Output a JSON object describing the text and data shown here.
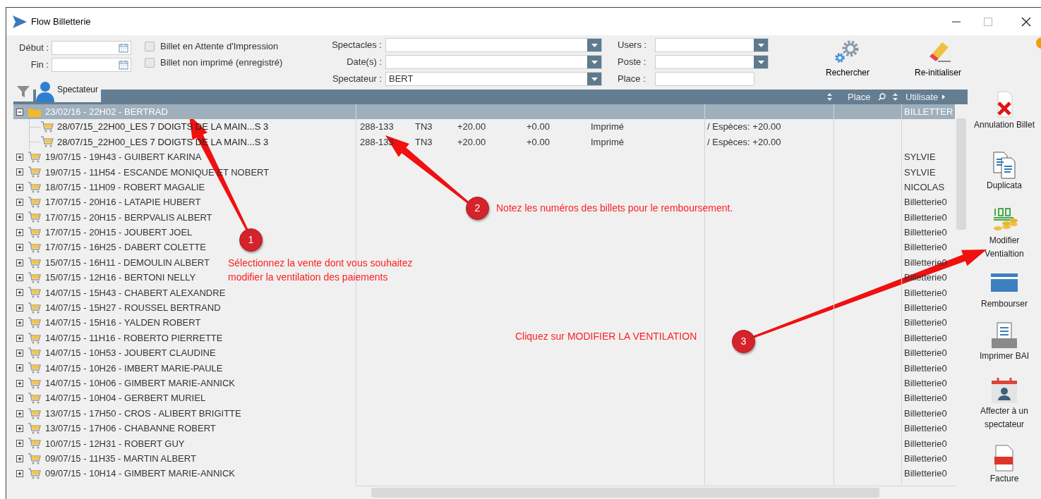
{
  "window": {
    "title": "Flow Billetterie"
  },
  "filters": {
    "dates": [
      {
        "label": "Début :"
      },
      {
        "label": "Fin :"
      }
    ],
    "checkboxes": [
      {
        "label": "Billet en Attente d'Impression",
        "checked": false
      },
      {
        "label": "Billet non imprimé (enregistré)",
        "checked": false
      }
    ],
    "combos": [
      {
        "label": "Spectacles :"
      },
      {
        "label": "Date(s) :"
      },
      {
        "label": "Spectateur :",
        "value": "BERT"
      }
    ],
    "combos_2": [
      {
        "label": "Users :",
        "kind": "dropdown"
      },
      {
        "label": "Poste :",
        "kind": "dropdown"
      },
      {
        "label": "Place :",
        "kind": "text"
      }
    ],
    "actions": [
      {
        "label": "Rechercher",
        "kind": "search"
      },
      {
        "label": "Re-initialiser",
        "kind": "reset"
      }
    ]
  },
  "tab": {
    "label": "Spectateur",
    "selected": true
  },
  "grid": {
    "headers": [
      {
        "label": "Place"
      },
      {
        "label": "Utilisate"
      }
    ],
    "rows": [
      {
        "label": "23/02/16 - 22H02 - BERTRAD",
        "user": "BILLETTER",
        "expanded": true,
        "selected": true,
        "children": [
          {
            "label": "28/07/15_22H00_LES 7 DOIGTS DE LA MAIN...S 3",
            "ticket": "288-133",
            "tarif": "TN3",
            "amount": "+20.00",
            "discount": "+0.00",
            "status": "Imprimé",
            "payment": "/ Espèces: +20.00"
          },
          {
            "label": "28/07/15_22H00_LES 7 DOIGTS DE LA MAIN...S 3",
            "ticket": "288-133",
            "tarif": "TN3",
            "amount": "+20.00",
            "discount": "+0.00",
            "status": "Imprimé",
            "payment": "/ Espèces: +20.00"
          }
        ]
      },
      {
        "label": "19/07/15 - 19H43 - GUIBERT KARINA",
        "user": "SYLVIE",
        "expanded": false,
        "selected": false
      },
      {
        "label": "19/07/15 - 11H54 - ESCANDE MONIQUE ET NOBERT",
        "user": "SYLVIE",
        "expanded": false,
        "selected": false
      },
      {
        "label": "18/07/15 - 11H09 - ROBERT MAGALIE",
        "user": "NICOLAS",
        "expanded": false,
        "selected": false
      },
      {
        "label": "17/07/15 - 20H16 - LATAPIE HUBERT",
        "user": "Billetterie0",
        "expanded": false,
        "selected": false
      },
      {
        "label": "17/07/15 - 20H15 - BERPVALIS ALBERT",
        "user": "Billetterie0",
        "expanded": false,
        "selected": false
      },
      {
        "label": "17/07/15 - 20H15 - JOUBERT JOEL",
        "user": "Billetterie0",
        "expanded": false,
        "selected": false
      },
      {
        "label": "17/07/15 - 16H25 - DABERT COLETTE",
        "user": "Billetterie0",
        "expanded": false,
        "selected": false
      },
      {
        "label": "15/07/15 - 16H11 - DEMOULIN ALBERT",
        "user": "Billetterie0",
        "expanded": false,
        "selected": false
      },
      {
        "label": "15/07/15 - 12H16 - BERTONI NELLY",
        "user": "Billetterie0",
        "expanded": false,
        "selected": false
      },
      {
        "label": "14/07/15 - 15H43 - CHABERT ALEXANDRE",
        "user": "Billetterie0",
        "expanded": false,
        "selected": false
      },
      {
        "label": "14/07/15 - 15H27 - ROUSSEL BERTRAND",
        "user": "Billetterie0",
        "expanded": false,
        "selected": false
      },
      {
        "label": "14/07/15 - 15H16 - YALDEN ROBERT",
        "user": "Billetterie0",
        "expanded": false,
        "selected": false
      },
      {
        "label": "14/07/15 - 11H16 - ROBERTO PIERRETTE",
        "user": "Billetterie0",
        "expanded": false,
        "selected": false
      },
      {
        "label": "14/07/15 - 10H53 - JOUBERT CLAUDINE",
        "user": "Billetterie0",
        "expanded": false,
        "selected": false
      },
      {
        "label": "14/07/15 - 10H26 - IMBERT MARIE-PAULE",
        "user": "Billetterie0",
        "expanded": false,
        "selected": false
      },
      {
        "label": "14/07/15 - 10H06 - GIMBERT MARIE-ANNICK",
        "user": "Billetterie0",
        "expanded": false,
        "selected": false
      },
      {
        "label": "14/07/15 - 10H04 - GERBERT MURIEL",
        "user": "Billetterie0",
        "expanded": false,
        "selected": false
      },
      {
        "label": "13/07/15 - 17H50 - CROS - ALIBERT BRIGITTE",
        "user": "Billetterie0",
        "expanded": false,
        "selected": false
      },
      {
        "label": "13/07/15 - 17H06 - CHABANNE ROBERT",
        "user": "Billetterie0",
        "expanded": false,
        "selected": false
      },
      {
        "label": "10/07/15 - 12H31 - ROBERT GUY",
        "user": "Billetterie0",
        "expanded": false,
        "selected": false
      },
      {
        "label": "09/07/15 - 11H35 - MARTIN ALBERT",
        "user": "Billetterie0",
        "expanded": false,
        "selected": false
      },
      {
        "label": "09/07/15 - 10H14 - GIMBERT MARIE-ANNICK",
        "user": "Billetterie0",
        "expanded": false,
        "selected": false
      }
    ]
  },
  "toolbar": [
    {
      "label": "Annulation Billet",
      "kind": "cancel"
    },
    {
      "label": "Duplicata",
      "kind": "duplicate"
    },
    {
      "label": "Modifier Ventialtion",
      "kind": "ventilation"
    },
    {
      "label": "Rembourser",
      "kind": "refund"
    },
    {
      "label": "Imprimer BAI",
      "kind": "print"
    },
    {
      "label": "Affecter à un spectateur",
      "kind": "assign"
    },
    {
      "label": "Facture",
      "kind": "invoice"
    }
  ],
  "annotations": [
    {
      "number": "1",
      "text": "Sélectionnez la vente dont vous souhaitez modifier la ventilation des paiements"
    },
    {
      "number": "2",
      "text": "Notez les numéros des billets pour le remboursement."
    },
    {
      "number": "3",
      "text": "Cliquez sur MODIFIER LA VENTILATION"
    }
  ]
}
